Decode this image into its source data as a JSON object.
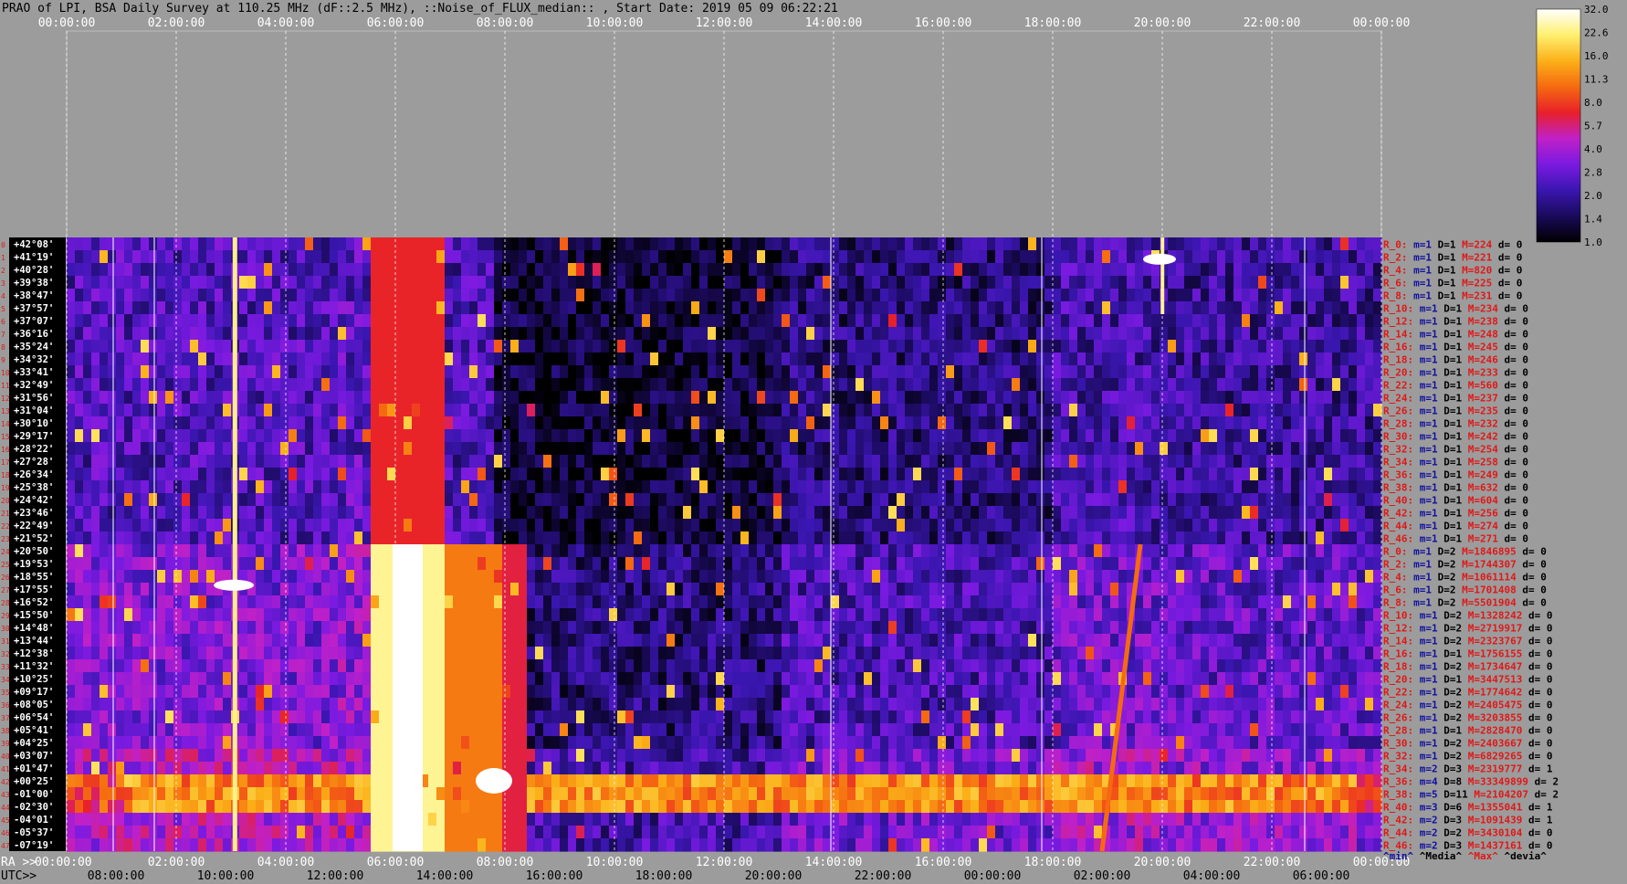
{
  "title": "PRAO of LPI, BSA Daily Survey at 110.25 MHz (dF::2.5 MHz), ::Noise_of_FLUX_median:: , Start Date: 2019 05 09 06:22:21",
  "chart_data": {
    "type": "heatmap",
    "title": "PRAO of LPI, BSA Daily Survey at 110.25 MHz (dF::2.5 MHz), ::Noise_of_FLUX_median:: , Start Date: 2019 05 09 06:22:21",
    "ra_ticks_top": [
      "00:00:00",
      "02:00:00",
      "04:00:00",
      "06:00:00",
      "08:00:00",
      "10:00:00",
      "12:00:00",
      "14:00:00",
      "16:00:00",
      "18:00:00",
      "20:00:00",
      "22:00:00",
      "00:00:00"
    ],
    "ra_label": "RA >>",
    "ra_ticks_bottom": [
      "00:00:00",
      "02:00:00",
      "04:00:00",
      "06:00:00",
      "08:00:00",
      "10:00:00",
      "12:00:00",
      "14:00:00",
      "16:00:00",
      "18:00:00",
      "20:00:00",
      "22:00:00",
      "00:00:00"
    ],
    "utc_label": "UTC>>",
    "utc_ticks": [
      "08:00:00",
      "10:00:00",
      "12:00:00",
      "14:00:00",
      "16:00:00",
      "18:00:00",
      "20:00:00",
      "22:00:00",
      "00:00:00",
      "02:00:00",
      "04:00:00",
      "06:00:00"
    ],
    "declinations": [
      "+42°08'",
      "+41°19'",
      "+40°28'",
      "+39°38'",
      "+38°47'",
      "+37°57'",
      "+37°07'",
      "+36°16'",
      "+35°24'",
      "+34°32'",
      "+33°41'",
      "+32°49'",
      "+31°56'",
      "+31°04'",
      "+30°10'",
      "+29°17'",
      "+28°22'",
      "+27°28'",
      "+26°34'",
      "+25°38'",
      "+24°42'",
      "+23°46'",
      "+22°49'",
      "+21°52'",
      "+20°50'",
      "+19°53'",
      "+18°55'",
      "+17°55'",
      "+16°52'",
      "+15°50'",
      "+14°48'",
      "+13°44'",
      "+12°38'",
      "+11°32'",
      "+10°25'",
      "+09°17'",
      "+08°05'",
      "+06°54'",
      "+05°41'",
      "+04°25'",
      "+03°07'",
      "+01°47'",
      "+00°25'",
      "-01°00'",
      "-02°30'",
      "-04°01'",
      "-05°37'",
      "-07°19'"
    ],
    "colorbar": {
      "ticks": [
        "32.0",
        "22.6",
        "16.0",
        "11.3",
        "8.0",
        "5.7",
        "4.0",
        "2.8",
        "2.0",
        "1.4",
        "1.0"
      ],
      "min": 1.0,
      "max": 32.0,
      "scale": "log2",
      "colors": [
        "#000000",
        "#1a0a5a",
        "#3a16b0",
        "#7a1ae0",
        "#c020c8",
        "#e8202a",
        "#f56a10",
        "#fbb018",
        "#fff070",
        "#ffffff"
      ]
    },
    "stats": [
      {
        "r": "R_0:",
        "m": "m=1",
        "d": "D=1",
        "M": "M=224",
        "dd": "d= 0"
      },
      {
        "r": "R_2:",
        "m": "m=1",
        "d": "D=1",
        "M": "M=221",
        "dd": "d= 0"
      },
      {
        "r": "R_4:",
        "m": "m=1",
        "d": "D=1",
        "M": "M=820",
        "dd": "d= 0"
      },
      {
        "r": "R_6:",
        "m": "m=1",
        "d": "D=1",
        "M": "M=225",
        "dd": "d= 0"
      },
      {
        "r": "R_8:",
        "m": "m=1",
        "d": "D=1",
        "M": "M=231",
        "dd": "d= 0"
      },
      {
        "r": "R_10:",
        "m": "m=1",
        "d": "D=1",
        "M": "M=234",
        "dd": "d= 0"
      },
      {
        "r": "R_12:",
        "m": "m=1",
        "d": "D=1",
        "M": "M=238",
        "dd": "d= 0"
      },
      {
        "r": "R_14:",
        "m": "m=1",
        "d": "D=1",
        "M": "M=248",
        "dd": "d= 0"
      },
      {
        "r": "R_16:",
        "m": "m=1",
        "d": "D=1",
        "M": "M=245",
        "dd": "d= 0"
      },
      {
        "r": "R_18:",
        "m": "m=1",
        "d": "D=1",
        "M": "M=246",
        "dd": "d= 0"
      },
      {
        "r": "R_20:",
        "m": "m=1",
        "d": "D=1",
        "M": "M=233",
        "dd": "d= 0"
      },
      {
        "r": "R_22:",
        "m": "m=1",
        "d": "D=1",
        "M": "M=560",
        "dd": "d= 0"
      },
      {
        "r": "R_24:",
        "m": "m=1",
        "d": "D=1",
        "M": "M=237",
        "dd": "d= 0"
      },
      {
        "r": "R_26:",
        "m": "m=1",
        "d": "D=1",
        "M": "M=235",
        "dd": "d= 0"
      },
      {
        "r": "R_28:",
        "m": "m=1",
        "d": "D=1",
        "M": "M=232",
        "dd": "d= 0"
      },
      {
        "r": "R_30:",
        "m": "m=1",
        "d": "D=1",
        "M": "M=242",
        "dd": "d= 0"
      },
      {
        "r": "R_32:",
        "m": "m=1",
        "d": "D=1",
        "M": "M=254",
        "dd": "d= 0"
      },
      {
        "r": "R_34:",
        "m": "m=1",
        "d": "D=1",
        "M": "M=258",
        "dd": "d= 0"
      },
      {
        "r": "R_36:",
        "m": "m=1",
        "d": "D=1",
        "M": "M=249",
        "dd": "d= 0"
      },
      {
        "r": "R_38:",
        "m": "m=1",
        "d": "D=1",
        "M": "M=632",
        "dd": "d= 0"
      },
      {
        "r": "R_40:",
        "m": "m=1",
        "d": "D=1",
        "M": "M=604",
        "dd": "d= 0"
      },
      {
        "r": "R_42:",
        "m": "m=1",
        "d": "D=1",
        "M": "M=256",
        "dd": "d= 0"
      },
      {
        "r": "R_44:",
        "m": "m=1",
        "d": "D=1",
        "M": "M=274",
        "dd": "d= 0"
      },
      {
        "r": "R_46:",
        "m": "m=1",
        "d": "D=1",
        "M": "M=271",
        "dd": "d= 0"
      },
      {
        "r": "R_0:",
        "m": "m=1",
        "d": "D=2",
        "M": "M=1846895",
        "dd": "d= 0"
      },
      {
        "r": "R_2:",
        "m": "m=1",
        "d": "D=2",
        "M": "M=1744307",
        "dd": "d= 0"
      },
      {
        "r": "R_4:",
        "m": "m=1",
        "d": "D=2",
        "M": "M=1061114",
        "dd": "d= 0"
      },
      {
        "r": "R_6:",
        "m": "m=1",
        "d": "D=2",
        "M": "M=1701408",
        "dd": "d= 0"
      },
      {
        "r": "R_8:",
        "m": "m=1",
        "d": "D=2",
        "M": "M=5501904",
        "dd": "d= 0"
      },
      {
        "r": "R_10:",
        "m": "m=1",
        "d": "D=2",
        "M": "M=1328242",
        "dd": "d= 0"
      },
      {
        "r": "R_12:",
        "m": "m=1",
        "d": "D=2",
        "M": "M=2719917",
        "dd": "d= 0"
      },
      {
        "r": "R_14:",
        "m": "m=1",
        "d": "D=2",
        "M": "M=2323767",
        "dd": "d= 0"
      },
      {
        "r": "R_16:",
        "m": "m=1",
        "d": "D=1",
        "M": "M=1756155",
        "dd": "d= 0"
      },
      {
        "r": "R_18:",
        "m": "m=1",
        "d": "D=2",
        "M": "M=1734647",
        "dd": "d= 0"
      },
      {
        "r": "R_20:",
        "m": "m=1",
        "d": "D=1",
        "M": "M=3447513",
        "dd": "d= 0"
      },
      {
        "r": "R_22:",
        "m": "m=1",
        "d": "D=2",
        "M": "M=1774642",
        "dd": "d= 0"
      },
      {
        "r": "R_24:",
        "m": "m=1",
        "d": "D=2",
        "M": "M=2405475",
        "dd": "d= 0"
      },
      {
        "r": "R_26:",
        "m": "m=1",
        "d": "D=2",
        "M": "M=3203855",
        "dd": "d= 0"
      },
      {
        "r": "R_28:",
        "m": "m=1",
        "d": "D=1",
        "M": "M=2828470",
        "dd": "d= 0"
      },
      {
        "r": "R_30:",
        "m": "m=1",
        "d": "D=2",
        "M": "M=2403667",
        "dd": "d= 0"
      },
      {
        "r": "R_32:",
        "m": "m=1",
        "d": "D=2",
        "M": "M=6829265",
        "dd": "d= 0"
      },
      {
        "r": "R_34:",
        "m": "m=2",
        "d": "D=3",
        "M": "M=2319777",
        "dd": "d= 1"
      },
      {
        "r": "R_36:",
        "m": "m=4",
        "d": "D=8",
        "M": "M=33349899",
        "dd": "d= 2"
      },
      {
        "r": "R_38:",
        "m": "m=5",
        "d": "D=11",
        "M": "M=2104207",
        "dd": "d= 2"
      },
      {
        "r": "R_40:",
        "m": "m=3",
        "d": "D=6",
        "M": "M=1355041",
        "dd": "d= 1"
      },
      {
        "r": "R_42:",
        "m": "m=2",
        "d": "D=3",
        "M": "M=1091439",
        "dd": "d= 1"
      },
      {
        "r": "R_44:",
        "m": "m=2",
        "d": "D=2",
        "M": "M=3430104",
        "dd": "d= 0"
      },
      {
        "r": "R_46:",
        "m": "m=2",
        "d": "D=3",
        "M": "M=1437161",
        "dd": "d= 0"
      }
    ],
    "stats_legend": [
      "^min^",
      "^Media^",
      "^Max^",
      "^devia^"
    ],
    "legend_colors": [
      "#1010a0",
      "#000000",
      "#e01818",
      "#000000"
    ]
  }
}
